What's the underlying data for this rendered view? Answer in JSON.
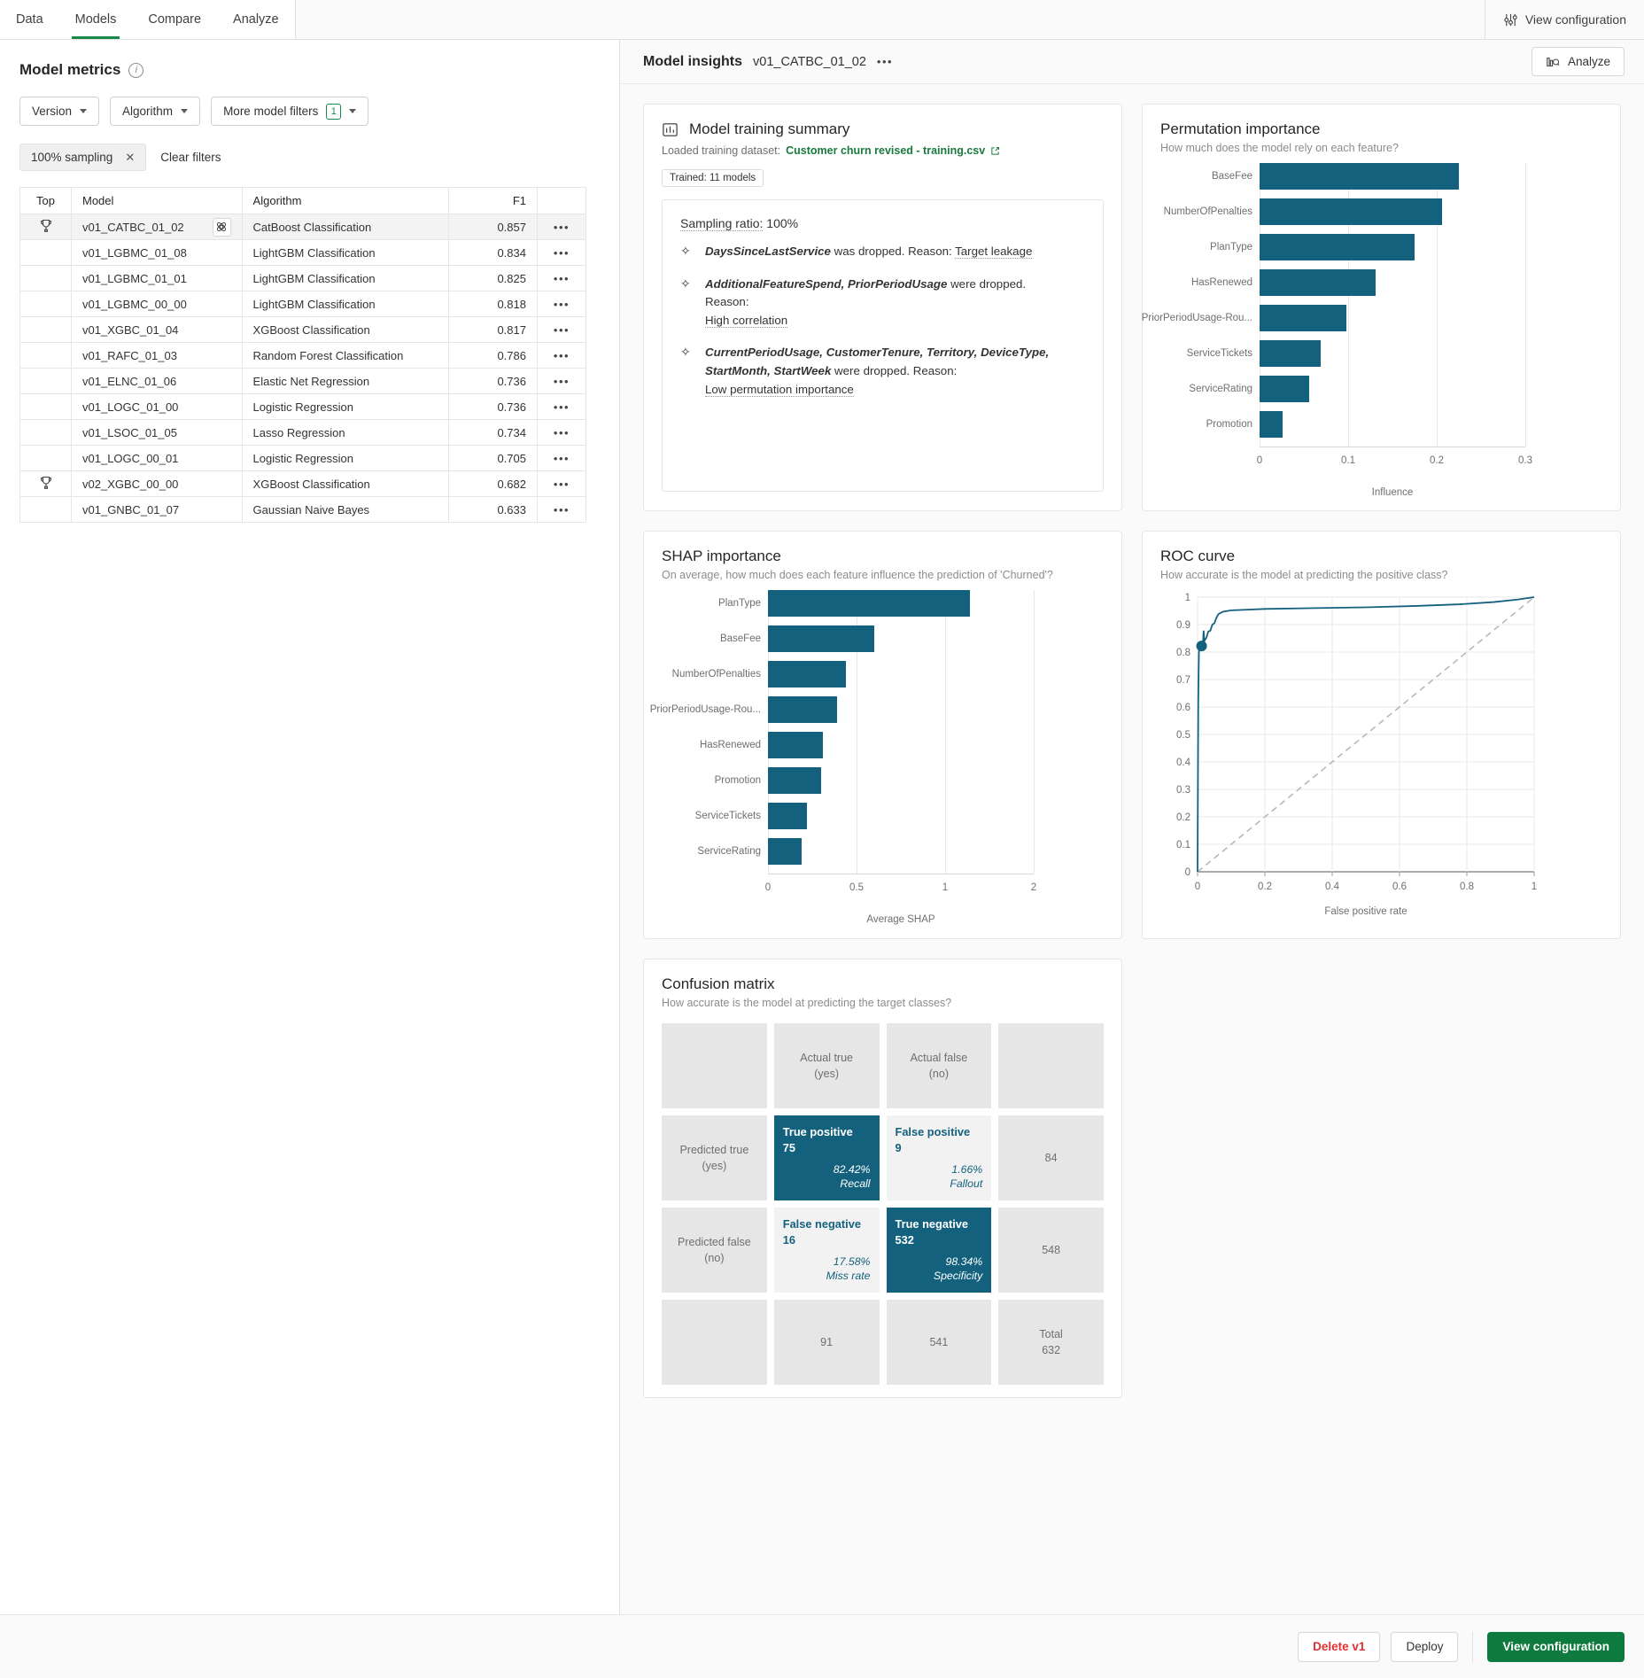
{
  "nav": {
    "tabs": [
      {
        "label": "Data",
        "active": false
      },
      {
        "label": "Models",
        "active": true
      },
      {
        "label": "Compare",
        "active": false
      },
      {
        "label": "Analyze",
        "active": false
      }
    ],
    "view_configuration": "View configuration",
    "view_configuration_icon": "sliders-icon"
  },
  "left": {
    "title": "Model metrics",
    "info_icon": "info-icon",
    "filters": [
      {
        "label": "Version",
        "badge": null
      },
      {
        "label": "Algorithm",
        "badge": null
      },
      {
        "label": "More model filters",
        "badge": "1"
      }
    ],
    "active_chip": "100% sampling",
    "clear_filters": "Clear filters",
    "table": {
      "columns": [
        "Top",
        "Model",
        "Algorithm",
        "F1",
        ""
      ],
      "rows": [
        {
          "top": "trophy-icon",
          "model": "v01_CATBC_01_02",
          "algorithm": "CatBoost Classification",
          "f1": "0.857",
          "selected": true,
          "atom": true
        },
        {
          "top": "",
          "model": "v01_LGBMC_01_08",
          "algorithm": "LightGBM Classification",
          "f1": "0.834",
          "selected": false,
          "atom": false
        },
        {
          "top": "",
          "model": "v01_LGBMC_01_01",
          "algorithm": "LightGBM Classification",
          "f1": "0.825",
          "selected": false,
          "atom": false
        },
        {
          "top": "",
          "model": "v01_LGBMC_00_00",
          "algorithm": "LightGBM Classification",
          "f1": "0.818",
          "selected": false,
          "atom": false
        },
        {
          "top": "",
          "model": "v01_XGBC_01_04",
          "algorithm": "XGBoost Classification",
          "f1": "0.817",
          "selected": false,
          "atom": false
        },
        {
          "top": "",
          "model": "v01_RAFC_01_03",
          "algorithm": "Random Forest Classification",
          "f1": "0.786",
          "selected": false,
          "atom": false
        },
        {
          "top": "",
          "model": "v01_ELNC_01_06",
          "algorithm": "Elastic Net Regression",
          "f1": "0.736",
          "selected": false,
          "atom": false
        },
        {
          "top": "",
          "model": "v01_LOGC_01_00",
          "algorithm": "Logistic Regression",
          "f1": "0.736",
          "selected": false,
          "atom": false
        },
        {
          "top": "",
          "model": "v01_LSOC_01_05",
          "algorithm": "Lasso Regression",
          "f1": "0.734",
          "selected": false,
          "atom": false
        },
        {
          "top": "",
          "model": "v01_LOGC_00_01",
          "algorithm": "Logistic Regression",
          "f1": "0.705",
          "selected": false,
          "atom": false
        },
        {
          "top": "trophy-icon",
          "model": "v02_XGBC_00_00",
          "algorithm": "XGBoost Classification",
          "f1": "0.682",
          "selected": false,
          "atom": false
        },
        {
          "top": "",
          "model": "v01_GNBC_01_07",
          "algorithm": "Gaussian Naive Bayes",
          "f1": "0.633",
          "selected": false,
          "atom": false
        }
      ],
      "row_menu": "•••"
    }
  },
  "insights": {
    "title": "Model insights",
    "model_name": "v01_CATBC_01_02",
    "overflow": "•••",
    "analyze_label": "Analyze",
    "analyze_icon": "analyze-icon"
  },
  "training_summary": {
    "icon": "chart-icon",
    "title": "Model training summary",
    "dataset_prefix": "Loaded training dataset:",
    "dataset_name": "Customer churn revised - training.csv",
    "dataset_link_icon": "external-link-icon",
    "trained_pill": "Trained: 11 models",
    "sampling_label": "Sampling ratio:",
    "sampling_value": "100%",
    "notes": [
      {
        "icon": "sparkle-icon",
        "features": "DaysSinceLastService",
        "text": " was dropped. Reason: ",
        "reason": "Target leakage",
        "inline": true
      },
      {
        "icon": "sparkle-icon",
        "features": "AdditionalFeatureSpend, PriorPeriodUsage",
        "text": " were dropped.",
        "reason_label": "Reason:",
        "reason": "High correlation",
        "inline": false
      },
      {
        "icon": "sparkle-icon",
        "features": "CurrentPeriodUsage, CustomerTenure, Territory, DeviceType, StartMonth, StartWeek",
        "text": " were dropped. Reason:",
        "reason": "Low permutation importance",
        "inline": false
      }
    ]
  },
  "chart_data": [
    {
      "type": "bar",
      "orientation": "horizontal",
      "title": "Permutation importance",
      "subtitle": "How much does the model rely on each feature?",
      "xlabel": "Influence",
      "ylabel": "",
      "xlim": [
        0,
        0.3
      ],
      "xticks": [
        "0",
        "0.1",
        "0.2",
        "0.3"
      ],
      "xtick_values": [
        0,
        0.1,
        0.2,
        0.3
      ],
      "grid": true,
      "legend": "none",
      "color": "#14617e",
      "categories": [
        "BaseFee",
        "NumberOfPenalties",
        "PlanType",
        "HasRenewed",
        "PriorPeriodUsage-Rou...",
        "ServiceTickets",
        "ServiceRating",
        "Promotion"
      ],
      "values": [
        0.225,
        0.206,
        0.175,
        0.131,
        0.098,
        0.069,
        0.056,
        0.026
      ]
    },
    {
      "type": "bar",
      "orientation": "horizontal",
      "title": "SHAP importance",
      "subtitle": "On average, how much does each feature influence the prediction of 'Churned'?",
      "xlabel": "Average SHAP",
      "ylabel": "",
      "xlim": [
        0,
        2
      ],
      "xticks": [
        "0",
        "0.5",
        "1",
        "2"
      ],
      "xtick_values": [
        0,
        0.5,
        1,
        2
      ],
      "grid": true,
      "legend": "none",
      "color": "#14617e",
      "categories": [
        "PlanType",
        "BaseFee",
        "NumberOfPenalties",
        "PriorPeriodUsage-Rou...",
        "HasRenewed",
        "Promotion",
        "ServiceTickets",
        "ServiceRating"
      ],
      "values": [
        1.28,
        0.6,
        0.44,
        0.39,
        0.31,
        0.3,
        0.22,
        0.19
      ]
    },
    {
      "type": "line",
      "title": "ROC curve",
      "subtitle": "How accurate is the model at predicting the positive class?",
      "xlabel": "False positive rate",
      "ylabel": "",
      "xlim": [
        0,
        1
      ],
      "ylim": [
        0,
        1
      ],
      "xticks": [
        "0",
        "0.2",
        "0.4",
        "0.6",
        "0.8",
        "1"
      ],
      "yticks": [
        "0",
        "0.1",
        "0.2",
        "0.3",
        "0.4",
        "0.5",
        "0.6",
        "0.7",
        "0.8",
        "0.9",
        "1"
      ],
      "grid": true,
      "legend": "none",
      "color": "#14617e",
      "series": [
        {
          "name": "ROC",
          "points": [
            [
              0,
              0
            ],
            [
              0.002,
              0.62
            ],
            [
              0.004,
              0.8
            ],
            [
              0.006,
              0.818
            ],
            [
              0.01,
              0.822
            ],
            [
              0.016,
              0.83
            ],
            [
              0.018,
              0.878
            ],
            [
              0.02,
              0.84
            ],
            [
              0.026,
              0.852
            ],
            [
              0.032,
              0.875
            ],
            [
              0.038,
              0.878
            ],
            [
              0.044,
              0.9
            ],
            [
              0.05,
              0.905
            ],
            [
              0.056,
              0.925
            ],
            [
              0.062,
              0.938
            ],
            [
              0.075,
              0.947
            ],
            [
              0.1,
              0.952
            ],
            [
              0.2,
              0.957
            ],
            [
              0.35,
              0.96
            ],
            [
              0.5,
              0.963
            ],
            [
              0.65,
              0.968
            ],
            [
              0.78,
              0.974
            ],
            [
              0.88,
              0.982
            ],
            [
              0.95,
              0.991
            ],
            [
              1,
              1
            ]
          ]
        },
        {
          "name": "Baseline",
          "style": "dashed",
          "color": "#b8b8b8",
          "points": [
            [
              0,
              0
            ],
            [
              1,
              1
            ]
          ]
        }
      ],
      "operating_point": [
        0.012,
        0.822
      ]
    }
  ],
  "confusion_matrix": {
    "title": "Confusion matrix",
    "subtitle": "How accurate is the model at predicting the target classes?",
    "col_headers": [
      "Actual true\n(yes)",
      "Actual false\n(no)"
    ],
    "row_headers": [
      "Predicted true\n(yes)",
      "Predicted false\n(no)"
    ],
    "cells": [
      {
        "label": "True positive",
        "value": "75",
        "rate": "82.42%",
        "rate_label": "Recall",
        "style": "fill"
      },
      {
        "label": "False positive",
        "value": "9",
        "rate": "1.66%",
        "rate_label": "Fallout",
        "style": "light"
      },
      {
        "label": "False negative",
        "value": "16",
        "rate": "17.58%",
        "rate_label": "Miss rate",
        "style": "light"
      },
      {
        "label": "True negative",
        "value": "532",
        "rate": "98.34%",
        "rate_label": "Specificity",
        "style": "fill"
      }
    ],
    "row_totals": [
      "84",
      "548"
    ],
    "col_totals": [
      "91",
      "541"
    ],
    "total_label": "Total",
    "total_value": "632"
  },
  "footer": {
    "delete_label": "Delete v1",
    "deploy_label": "Deploy",
    "view_config_label": "View configuration"
  }
}
